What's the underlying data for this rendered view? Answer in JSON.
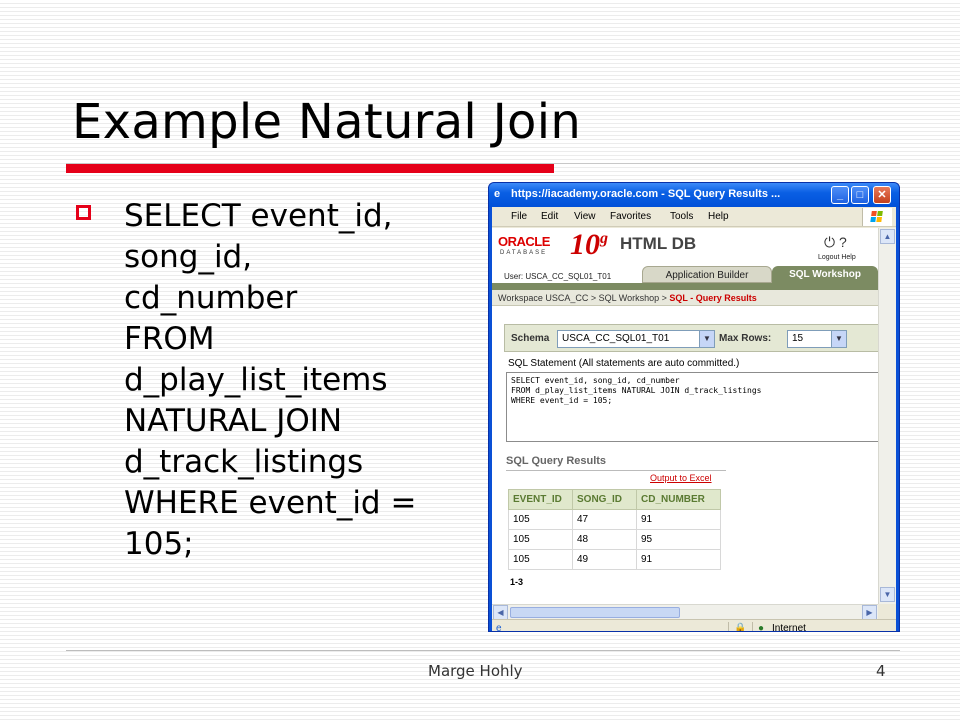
{
  "slide": {
    "title": "Example Natural Join",
    "bullet_lines": [
      "SELECT event_id,",
      "song_id,",
      "cd_number",
      "FROM",
      "d_play_list_items",
      "NATURAL JOIN",
      "d_track_listings",
      "WHERE event_id =",
      "105;"
    ],
    "footer_author": "Marge Hohly",
    "page_number": "4",
    "accent_color": "#e50019"
  },
  "browser": {
    "title": "https://iacademy.oracle.com - SQL Query Results ...",
    "window_buttons": [
      "_",
      "□",
      "✕"
    ],
    "menu": [
      "File",
      "Edit",
      "View",
      "Favorites",
      "Tools",
      "Help"
    ],
    "status_zone": "Internet"
  },
  "app": {
    "logo": "ORACLE",
    "logo_sub": "DATABASE",
    "version": "10",
    "version_sup": "g",
    "product": "HTML DB",
    "user": "User: USCA_CC_SQL01_T01",
    "tabs": [
      "Application Builder",
      "SQL Workshop"
    ],
    "logout_help": "Logout  Help",
    "breadcrumb_path": "Workspace USCA_CC > SQL Workshop > ",
    "breadcrumb_current": "SQL - Query Results",
    "schema_label": "Schema",
    "schema_value": "USCA_CC_SQL01_T01",
    "max_rows_label": "Max Rows:",
    "max_rows_value": "15",
    "sql_statement_label": "SQL Statement (All statements are auto committed.)",
    "sql_text": "SELECT event_id, song_id, cd_number\nFROM d_play_list_items NATURAL JOIN d_track_listings\nWHERE event_id = 105;",
    "results_title": "SQL Query Results",
    "output_link": "Output to Excel",
    "results": {
      "columns": [
        "EVENT_ID",
        "SONG_ID",
        "CD_NUMBER"
      ],
      "rows": [
        [
          "105",
          "47",
          "91"
        ],
        [
          "105",
          "48",
          "95"
        ],
        [
          "105",
          "49",
          "91"
        ]
      ]
    },
    "row_count": "1-3"
  }
}
